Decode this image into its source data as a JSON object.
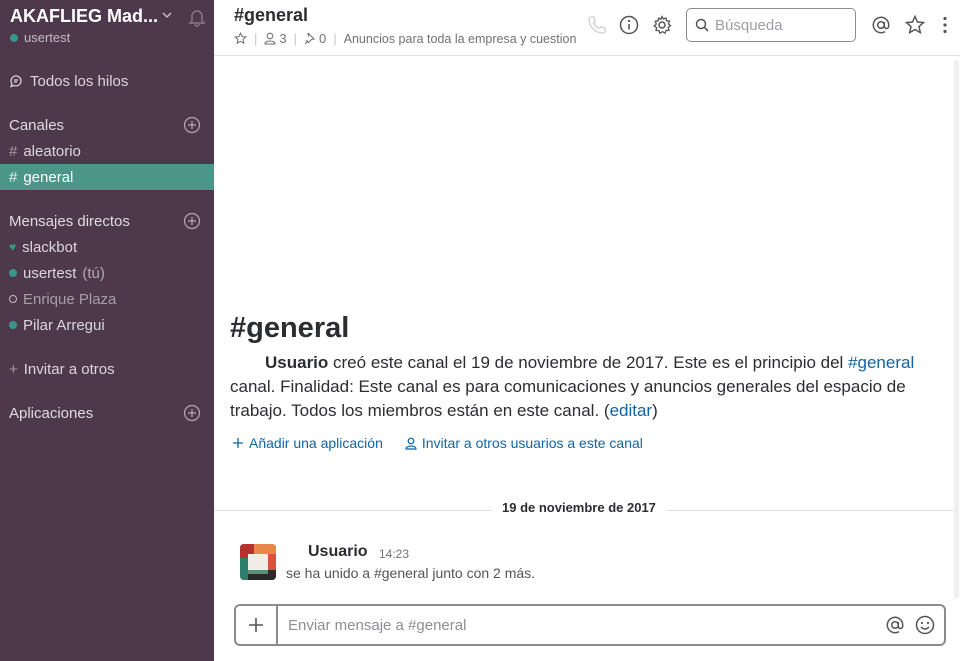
{
  "sidebar": {
    "team_name": "AKAFLIEG Mad...",
    "username": "usertest",
    "all_threads": "Todos los hilos",
    "channels_header": "Canales",
    "channels": [
      {
        "label": "aleatorio",
        "active": false
      },
      {
        "label": "general",
        "active": true
      }
    ],
    "dm_header": "Mensajes directos",
    "dms": [
      {
        "label": "slackbot",
        "status": "bot"
      },
      {
        "label": "usertest",
        "suffix": "(tú)",
        "status": "online"
      },
      {
        "label": "Enrique Plaza",
        "status": "away"
      },
      {
        "label": "Pilar Arregui",
        "status": "online"
      }
    ],
    "invite": "Invitar a otros",
    "apps_header": "Aplicaciones"
  },
  "header": {
    "channel_title": "#general",
    "members_count": "3",
    "pins_count": "0",
    "purpose": "Anuncios para toda la empresa y cuestion",
    "search_placeholder": "Búsqueda"
  },
  "intro": {
    "title": "#general",
    "user": "Usuario",
    "text_1": " creó este canal el 19 de noviembre de 2017. Este es el principio del ",
    "channel_link": "#general",
    "text_2": " canal. Finalidad: Este canal es para comunicaciones y anuncios generales del espacio de trabajo. Todos los miembros están en este canal. (",
    "edit_link": "editar",
    "text_3": ")",
    "add_app": "Añadir una aplicación",
    "invite_users": "Invitar a otros usuarios a este canal"
  },
  "day_divider": "19 de noviembre de 2017",
  "message": {
    "author": "Usuario",
    "time": "14:23",
    "body": "se ha unido a #general junto con 2 más."
  },
  "composer": {
    "placeholder": "Enviar mensaje a #general"
  },
  "colors": {
    "sidebar_bg": "#4d394b",
    "active_channel": "#4c9689",
    "online": "#38978d",
    "link": "#1264a3"
  }
}
